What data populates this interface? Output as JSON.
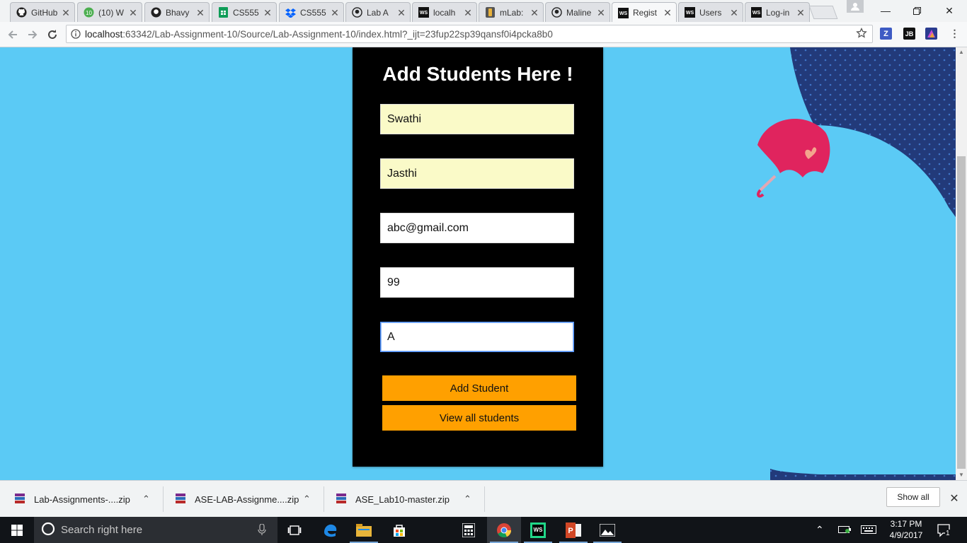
{
  "browser": {
    "tabs": [
      {
        "title": "GitHub",
        "icon": "github-icon"
      },
      {
        "title": "(10) W",
        "icon": "whatsapp-icon"
      },
      {
        "title": "Bhavy",
        "icon": "github-icon"
      },
      {
        "title": "CS555",
        "icon": "sheets-icon"
      },
      {
        "title": "CS555",
        "icon": "dropbox-icon"
      },
      {
        "title": "Lab A",
        "icon": "github-icon"
      },
      {
        "title": "localh",
        "icon": "webstorm-icon"
      },
      {
        "title": "mLab:",
        "icon": "mlab-icon"
      },
      {
        "title": "Maline",
        "icon": "github-icon"
      },
      {
        "title": "Regist",
        "icon": "webstorm-icon"
      },
      {
        "title": "Users",
        "icon": "webstorm-icon"
      },
      {
        "title": "Log-in",
        "icon": "webstorm-icon"
      }
    ],
    "url_host": "localhost",
    "url_rest": ":63342/Lab-Assignment-10/Source/Lab-Assignment-10/index.html?_ijt=23fup22sp39qansf0i4pcka8b0",
    "extensions": [
      "Z",
      "JB"
    ]
  },
  "page": {
    "heading": "Add Students Here !",
    "fields": {
      "first_name": "Swathi",
      "last_name": "Jasthi",
      "email": "abc@gmail.com",
      "score": "99",
      "grade": "A"
    },
    "add_button": "Add Student",
    "view_button": "View all students",
    "colors": {
      "background": "#5bcaf5",
      "card": "#000000",
      "button": "#ffa000",
      "autofill": "#fafac8",
      "umbrella": "#e0245e",
      "dotted_shape": "#223a7a"
    }
  },
  "downloads": {
    "items": [
      {
        "name": "Lab-Assignments-....zip"
      },
      {
        "name": "ASE-LAB-Assignme....zip"
      },
      {
        "name": "ASE_Lab10-master.zip"
      }
    ],
    "show_all": "Show all"
  },
  "taskbar": {
    "search_placeholder": "Search right here",
    "time": "3:17 PM",
    "date": "4/9/2017",
    "notification_count": "1"
  }
}
